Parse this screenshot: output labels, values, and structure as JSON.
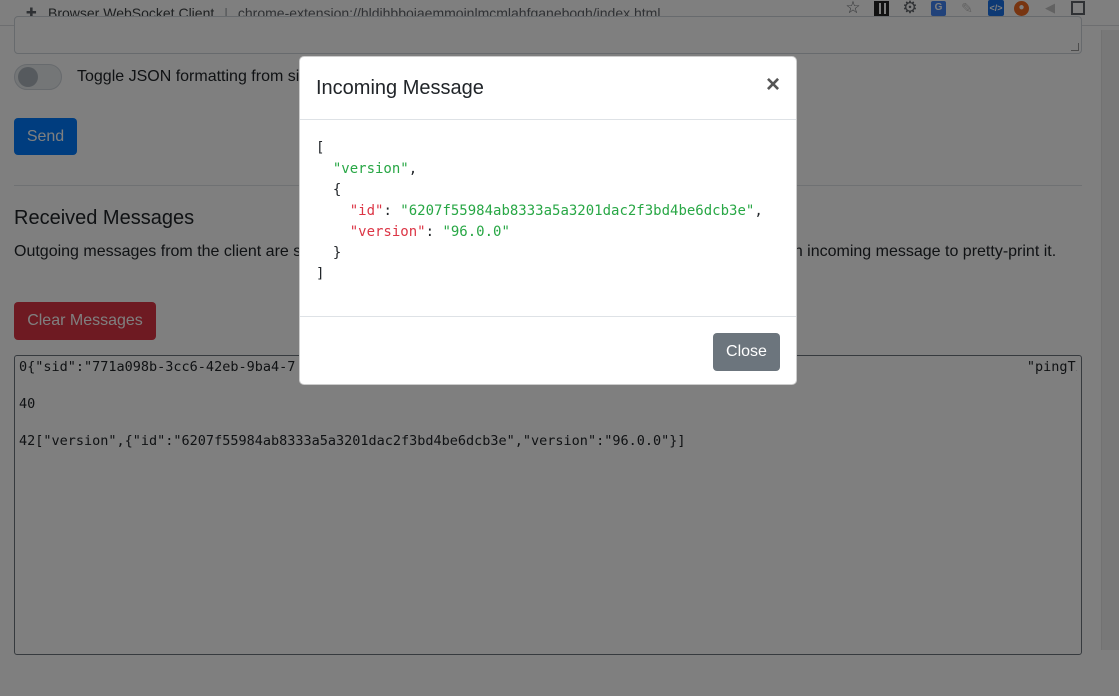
{
  "browser": {
    "extension_name": "Browser WebSocket Client",
    "separator": "|",
    "url": "chrome-extension://hldihbbojaemmoinlmcmlahfganebogh/index.html"
  },
  "form": {
    "toggle_label": "Toggle JSON formatting from si",
    "send_label": "Send"
  },
  "received": {
    "title": "Received Messages",
    "description": "Outgoing messages from the client are s                                                                                          Click on on an incoming message to pretty-print it.",
    "clear_label": "Clear Messages",
    "messages": [
      "0{\"sid\":\"771a098b-3cc6-42eb-9ba4-7                                                                                          \"pingTimeout\":60000}",
      "40",
      "42[\"version\",{\"id\":\"6207f55984ab8333a5a3201dac2f3bd4be6dcb3e\",\"version\":\"96.0.0\"}]"
    ]
  },
  "modal": {
    "title": "Incoming Message",
    "close_symbol": "×",
    "close_label": "Close",
    "json_lines": {
      "open_bracket": "[",
      "event_name": "\"version\"",
      "comma": ",",
      "open_brace": "{",
      "id_key": "\"id\"",
      "id_value": "\"6207f55984ab8333a5a3201dac2f3bd4be6dcb3e\"",
      "version_key": "\"version\"",
      "version_value": "\"96.0.0\"",
      "colon": ": ",
      "close_brace": "}",
      "close_bracket": "]"
    }
  },
  "colors": {
    "primary": "#007bff",
    "danger": "#dc3545",
    "secondary": "#6c757d",
    "json_string": "#28a745",
    "json_key": "#dc3545"
  }
}
